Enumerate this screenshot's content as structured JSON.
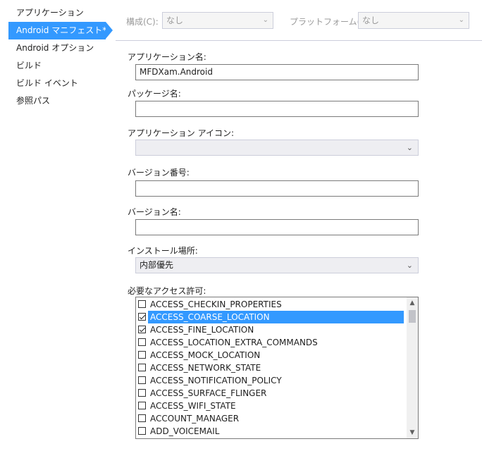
{
  "nav": {
    "items": [
      {
        "label": "アプリケーション",
        "active": false
      },
      {
        "label": "Android マニフェスト*",
        "active": true
      },
      {
        "label": "Android オプション",
        "active": false
      },
      {
        "label": "ビルド",
        "active": false
      },
      {
        "label": "ビルド イベント",
        "active": false
      },
      {
        "label": "参照パス",
        "active": false
      }
    ]
  },
  "topbar": {
    "config_label": "構成(C):",
    "config_value": "なし",
    "platform_label": "プラットフォーム(M):",
    "platform_value": "なし"
  },
  "form": {
    "app_name_label": "アプリケーション名:",
    "app_name_value": "MFDXam.Android",
    "package_label": "パッケージ名:",
    "package_value": "",
    "icon_label": "アプリケーション アイコン:",
    "icon_value": "",
    "version_number_label": "バージョン番号:",
    "version_number_value": "",
    "version_name_label": "バージョン名:",
    "version_name_value": "",
    "install_location_label": "インストール場所:",
    "install_location_value": "内部優先",
    "permissions_label": "必要なアクセス許可:"
  },
  "permissions": [
    {
      "name": "ACCESS_CHECKIN_PROPERTIES",
      "checked": false,
      "selected": false
    },
    {
      "name": "ACCESS_COARSE_LOCATION",
      "checked": true,
      "selected": true
    },
    {
      "name": "ACCESS_FINE_LOCATION",
      "checked": true,
      "selected": false
    },
    {
      "name": "ACCESS_LOCATION_EXTRA_COMMANDS",
      "checked": false,
      "selected": false
    },
    {
      "name": "ACCESS_MOCK_LOCATION",
      "checked": false,
      "selected": false
    },
    {
      "name": "ACCESS_NETWORK_STATE",
      "checked": false,
      "selected": false
    },
    {
      "name": "ACCESS_NOTIFICATION_POLICY",
      "checked": false,
      "selected": false
    },
    {
      "name": "ACCESS_SURFACE_FLINGER",
      "checked": false,
      "selected": false
    },
    {
      "name": "ACCESS_WIFI_STATE",
      "checked": false,
      "selected": false
    },
    {
      "name": "ACCOUNT_MANAGER",
      "checked": false,
      "selected": false
    },
    {
      "name": "ADD_VOICEMAIL",
      "checked": false,
      "selected": false
    }
  ],
  "colors": {
    "accent": "#3399ff",
    "border": "#7a7a7a",
    "disabled_border": "#cccedb"
  }
}
